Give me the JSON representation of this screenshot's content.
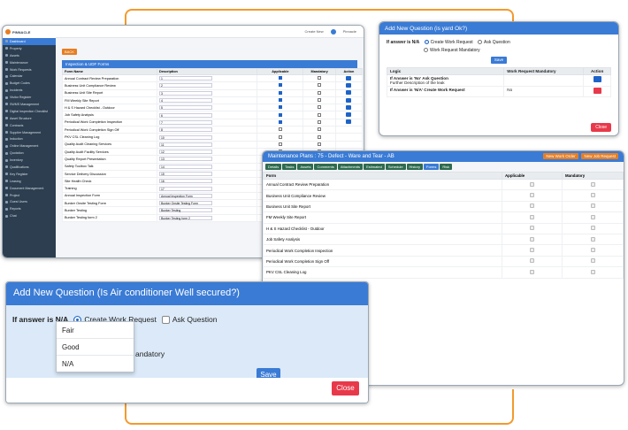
{
  "app": {
    "logo_text": "PINNACLE",
    "top_right_text": "Create New",
    "user_text": "Pinnacle",
    "sidebar": [
      "Dashboard",
      "Property",
      "Assets",
      "Maintenance",
      "Work Requests",
      "Calendar",
      "Budget Codes",
      "Incidents",
      "Visitor Register",
      "SWMS Management",
      "Digital Inspection Checklist",
      "Asset Structure",
      "Contracts",
      "Supplier Management",
      "Induction",
      "Online Management",
      "Quotation",
      "Inventory",
      "Qualifications",
      "Key Register",
      "Leasing",
      "Document Management",
      "Project",
      "Guest Users",
      "Reports",
      "Chat"
    ],
    "back_label": "BACK",
    "card_title": "Inspection & UDF Forms",
    "table_headers": [
      "Form Name",
      "Description",
      "Applicable",
      "Mandatory",
      "Action"
    ],
    "rows": [
      {
        "name": "Annual Contract Review Preparation",
        "desc": "1",
        "applicable": true
      },
      {
        "name": "Business Unit Compliance Review",
        "desc": "2",
        "applicable": true
      },
      {
        "name": "Business Unit Site Report",
        "desc": "3",
        "applicable": true
      },
      {
        "name": "FM Weekly Site Report",
        "desc": "4",
        "applicable": true
      },
      {
        "name": "H & S Hazard Checklist - Outdoor",
        "desc": "5",
        "applicable": true
      },
      {
        "name": "Job Safety Analysis",
        "desc": "6",
        "applicable": true
      },
      {
        "name": "Periodical Work Completion Inspection",
        "desc": "7",
        "applicable": true
      },
      {
        "name": "Periodical Work Completion Sign Off",
        "desc": "8",
        "applicable": false
      },
      {
        "name": "PKV CSL Cleaning Log",
        "desc": "10",
        "applicable": false
      },
      {
        "name": "Quality Audit Cleaning Services",
        "desc": "11",
        "applicable": false
      },
      {
        "name": "Quality Audit Facility Services",
        "desc": "12",
        "applicable": false
      },
      {
        "name": "Quality Report Presentation",
        "desc": "13",
        "applicable": false
      },
      {
        "name": "Safety Toolbox Talk",
        "desc": "14",
        "applicable": false
      },
      {
        "name": "Service Delivery Discussion",
        "desc": "15",
        "applicable": false
      },
      {
        "name": "Site Health Check",
        "desc": "16",
        "applicable": false
      },
      {
        "name": "Training",
        "desc": "17",
        "applicable": false
      },
      {
        "name": "Annual Inspection Form",
        "desc": "Annual Inspection Form",
        "applicable": false
      },
      {
        "name": "Bunker Onsite Testing Form",
        "desc": "Bunker Onsite Testing Form",
        "applicable": false
      },
      {
        "name": "Bunker Testing",
        "desc": "Bunker Testing",
        "applicable": false
      },
      {
        "name": "Bunker Testing form 2",
        "desc": "Bunker Testing form 2",
        "applicable": false
      }
    ]
  },
  "dialog_small": {
    "title": "Add New Question (is yard Ok?)",
    "answer_label": "If answer is N/A",
    "opt1": "Create Work Request",
    "opt2": "Ask Question",
    "opt3": "Work Request Mandatory",
    "save": "Save",
    "headers": [
      "Logic",
      "Work Request Mandatory",
      "Action"
    ],
    "rows": [
      {
        "logic": "If Answer is 'No' Ask Question",
        "sub": "Further Description of the leak",
        "mandatory": ""
      },
      {
        "logic": "If Answer is 'N/A' Create Work Request",
        "sub": "",
        "mandatory": "No"
      }
    ],
    "close": "Close"
  },
  "maint": {
    "title": "Maintenance Plans : 75 - Defect - Ware and Tear - AB",
    "btn_new_work_order": "New Work Order",
    "btn_new_job_request": "New Job Request",
    "tabs": [
      "Details",
      "Tasks",
      "Assets",
      "Comments",
      "Attachments",
      "Estimated",
      "Schedule",
      "History",
      "Forms",
      "Risk"
    ],
    "headers": [
      "Form",
      "Applicable",
      "Mandatory"
    ],
    "rows": [
      "Annual Contract Review Preparation",
      "Business Unit Compliance Review",
      "Business Unit Site Report",
      "FM Weekly Site Report",
      "H & S Hazard Checklist - Outdoor",
      "Job Safety Analysis",
      "Periodical Work Completion Inspection",
      "Periodical Work Completion Sign Off",
      "PKV CSL Cleaning Log"
    ]
  },
  "dialog_big": {
    "title": "Add New Question (Is Air conditioner Well secured?)",
    "answer_label": "If answer is N/A",
    "opt1": "Create Work Request",
    "opt2": "Ask Question",
    "mandatory_suffix": "andatory",
    "dropdown": [
      "Fair",
      "Good",
      "N/A"
    ],
    "save": "Save",
    "close": "Close"
  }
}
